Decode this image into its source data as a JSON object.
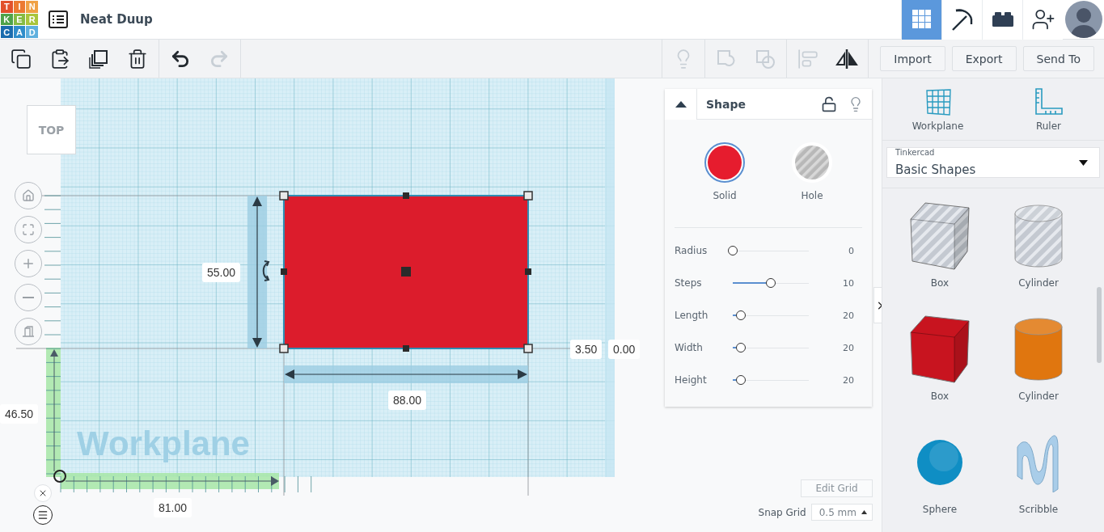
{
  "header": {
    "logo": [
      {
        "letter": "T",
        "color": "#e2512c"
      },
      {
        "letter": "I",
        "color": "#ec7a31"
      },
      {
        "letter": "N",
        "color": "#f0a145"
      },
      {
        "letter": "K",
        "color": "#4fa34a"
      },
      {
        "letter": "E",
        "color": "#86bb43"
      },
      {
        "letter": "R",
        "color": "#a9c53c"
      },
      {
        "letter": "C",
        "color": "#1a6cae"
      },
      {
        "letter": "A",
        "color": "#2f8dca"
      },
      {
        "letter": "D",
        "color": "#5fb0de"
      }
    ],
    "project_title": "Neat Duup",
    "views": [
      {
        "kind": "grid",
        "selected": true
      },
      {
        "kind": "pickaxe",
        "selected": false
      },
      {
        "kind": "bricks",
        "selected": false
      }
    ]
  },
  "toolbar": {
    "edit_tools": [
      {
        "kind": "copy",
        "disabled": false
      },
      {
        "kind": "paste",
        "disabled": false
      },
      {
        "kind": "duplicate",
        "disabled": false
      },
      {
        "kind": "delete",
        "disabled": false
      },
      {
        "kind": "undo",
        "disabled": false
      },
      {
        "kind": "redo",
        "disabled": true
      }
    ],
    "shape_tools": [
      {
        "kind": "hint",
        "disabled": true
      },
      {
        "kind": "group",
        "disabled": true
      },
      {
        "kind": "ungroup",
        "disabled": true
      },
      {
        "kind": "align",
        "disabled": true
      },
      {
        "kind": "mirror",
        "disabled": false
      }
    ],
    "buttons": [
      "Import",
      "Export",
      "Send To"
    ]
  },
  "workplane": {
    "view_cube": "TOP",
    "label": "Workplane",
    "measurements": [
      "55.00",
      "88.00",
      "3.50",
      "0.00",
      "46.50",
      "81.00"
    ]
  },
  "shape_panel": {
    "title": "Shape",
    "modes": [
      {
        "label": "Solid",
        "selected": true
      },
      {
        "label": "Hole",
        "selected": false
      }
    ],
    "properties": [
      {
        "label": "Radius",
        "level": 0,
        "value": "0"
      },
      {
        "label": "Steps",
        "level": 0.5,
        "value": "10"
      },
      {
        "label": "Length",
        "level": 0.11,
        "value": "20"
      },
      {
        "label": "Width",
        "level": 0.11,
        "value": "20"
      },
      {
        "label": "Height",
        "level": 0.11,
        "value": "20"
      }
    ]
  },
  "grid_settings": {
    "edit_button": "Edit Grid",
    "snap_label": "Snap Grid",
    "snap_value": "0.5 mm"
  },
  "sidebar": {
    "tools": [
      {
        "kind": "workplane",
        "label": "Workplane"
      },
      {
        "kind": "ruler",
        "label": "Ruler"
      }
    ],
    "library": {
      "provider": "Tinkercad",
      "collection": "Basic Shapes"
    },
    "shapes": [
      {
        "label": "Box",
        "kind": "box",
        "hole": true,
        "color": "#c4c9d1"
      },
      {
        "label": "Cylinder",
        "kind": "cylinder",
        "hole": true,
        "color": "#c4c9d1"
      },
      {
        "label": "Box",
        "kind": "box",
        "hole": false,
        "color": "#c8141f"
      },
      {
        "label": "Cylinder",
        "kind": "cylinder",
        "hole": false,
        "color": "#e0760f"
      },
      {
        "label": "Sphere",
        "kind": "sphere",
        "hole": false,
        "color": "#0f8ec4"
      },
      {
        "label": "Scribble",
        "kind": "scribble",
        "hole": false,
        "color": "#a9cde9"
      }
    ]
  }
}
